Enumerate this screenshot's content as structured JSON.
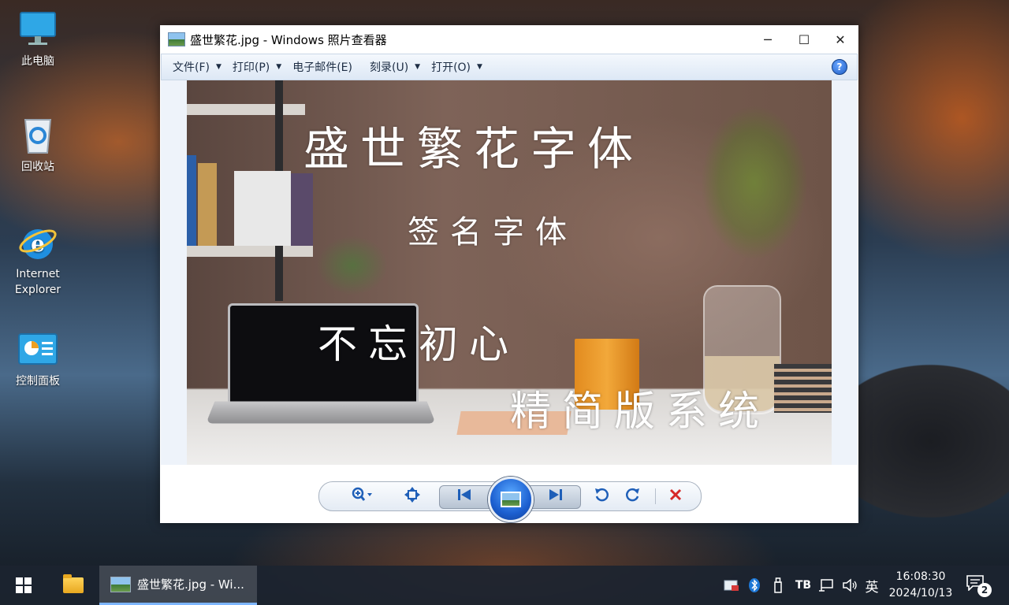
{
  "desktop": {
    "icons": [
      {
        "label": "此电脑",
        "icon": "computer-icon"
      },
      {
        "label": "回收站",
        "icon": "recycle-bin-icon"
      },
      {
        "label": "Internet Explorer",
        "icon": "internet-explorer-icon"
      },
      {
        "label": "控制面板",
        "icon": "control-panel-icon"
      }
    ]
  },
  "window": {
    "title": "盛世繁花.jpg - Windows 照片查看器",
    "controls": {
      "minimize": "─",
      "maximize": "☐",
      "close": "✕"
    },
    "menu": [
      {
        "label": "文件(F)",
        "has_dropdown": true
      },
      {
        "label": "打印(P)",
        "has_dropdown": true
      },
      {
        "label": "电子邮件(E)",
        "has_dropdown": false
      },
      {
        "label": "刻录(U)",
        "has_dropdown": true
      },
      {
        "label": "打开(O)",
        "has_dropdown": true
      }
    ],
    "help": "?",
    "photo_text": {
      "line1": "盛世繁花字体",
      "line2": "签名字体",
      "line3": "不忘初心",
      "line4": "精简版系统"
    },
    "toolbar": {
      "zoom": "zoom-icon",
      "actual_size": "actual-size-icon",
      "previous": "previous-icon",
      "slideshow": "slideshow-icon",
      "next": "next-icon",
      "rotate_left": "rotate-counterclockwise-icon",
      "rotate_right": "rotate-clockwise-icon",
      "delete": "delete-icon"
    }
  },
  "taskbar": {
    "active_app_title": "盛世繁花.jpg - Wi...",
    "ime": "英",
    "time": "16:08:30",
    "date": "2024/10/13",
    "notification_count": "2",
    "colors": {
      "accent": "#7eb6ff",
      "background": "#1c2430"
    }
  }
}
